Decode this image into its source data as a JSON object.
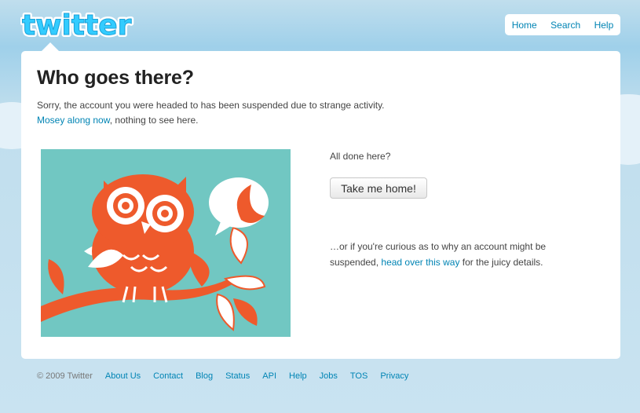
{
  "brand": {
    "logo_text": "twitter"
  },
  "topnav": [
    {
      "label": "Home"
    },
    {
      "label": "Search"
    },
    {
      "label": "Help"
    }
  ],
  "main": {
    "title": "Who goes there?",
    "message": "Sorry, the account you were headed to has been suspended due to strange activity.",
    "mosey_link": "Mosey along now",
    "mosey_rest": ", nothing to see here.",
    "done_text": "All done here?",
    "home_button": "Take me home!",
    "curious_before": "…or if you're curious as to why an account might be suspended, ",
    "curious_link": "head over this way",
    "curious_after": " for the juicy details."
  },
  "footer": {
    "copyright": "© 2009 Twitter",
    "links": [
      "About Us",
      "Contact",
      "Blog",
      "Status",
      "API",
      "Help",
      "Jobs",
      "TOS",
      "Privacy"
    ]
  },
  "colors": {
    "link": "#0084b4",
    "owl_orange": "#ee5a2c",
    "teal": "#71c7c2",
    "background": "#c0deed"
  }
}
